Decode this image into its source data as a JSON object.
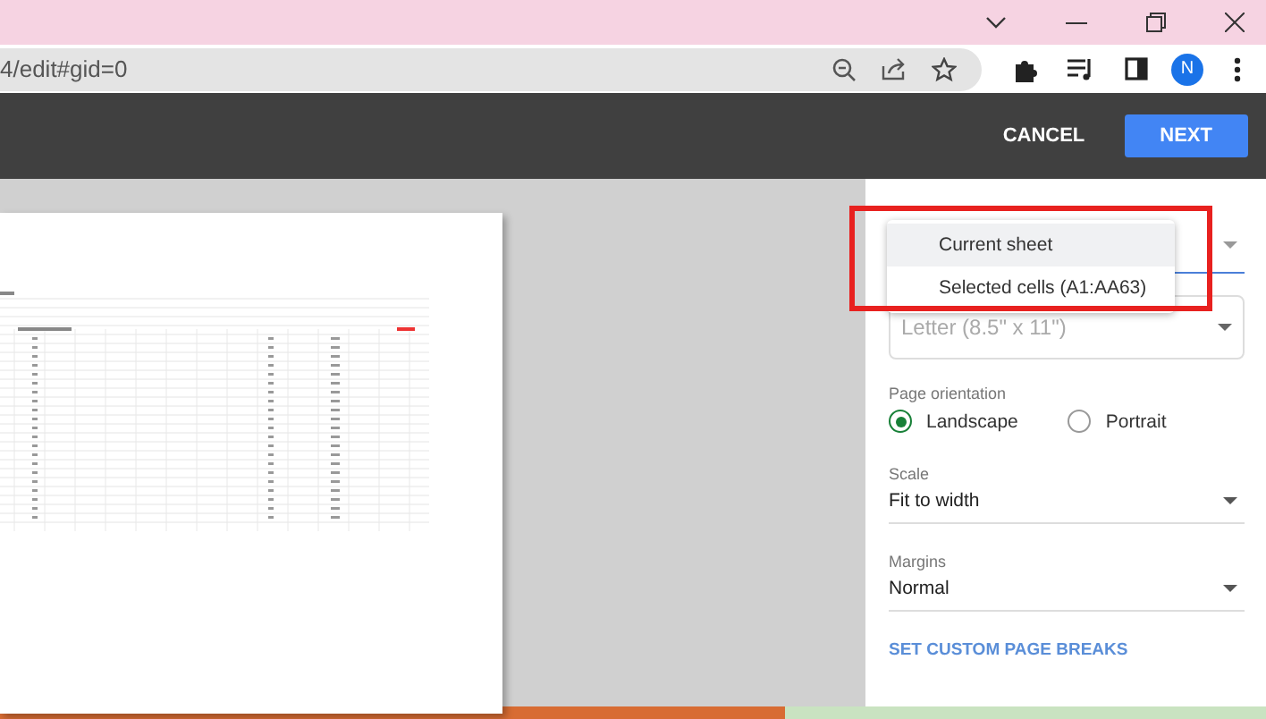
{
  "browser": {
    "url": "4/edit#gid=0",
    "profile_initial": "N"
  },
  "toolbar": {
    "buttons": [
      {
        "label": "CANCEL",
        "kind": "text"
      },
      {
        "label": "NEXT",
        "kind": "primary"
      }
    ]
  },
  "print_menu": {
    "options": [
      {
        "label": "Current sheet",
        "selected": true
      },
      {
        "label": "Selected cells (A1:AA63)",
        "selected": false
      }
    ]
  },
  "paper_size": {
    "value": "Letter (8.5\" x 11\")"
  },
  "orientation": {
    "label": "Page orientation",
    "options": [
      {
        "label": "Landscape",
        "selected": true
      },
      {
        "label": "Portrait",
        "selected": false
      }
    ]
  },
  "scale": {
    "label": "Scale",
    "value": "Fit to width"
  },
  "margins": {
    "label": "Margins",
    "value": "Normal"
  },
  "link": "SET CUSTOM PAGE BREAKS"
}
